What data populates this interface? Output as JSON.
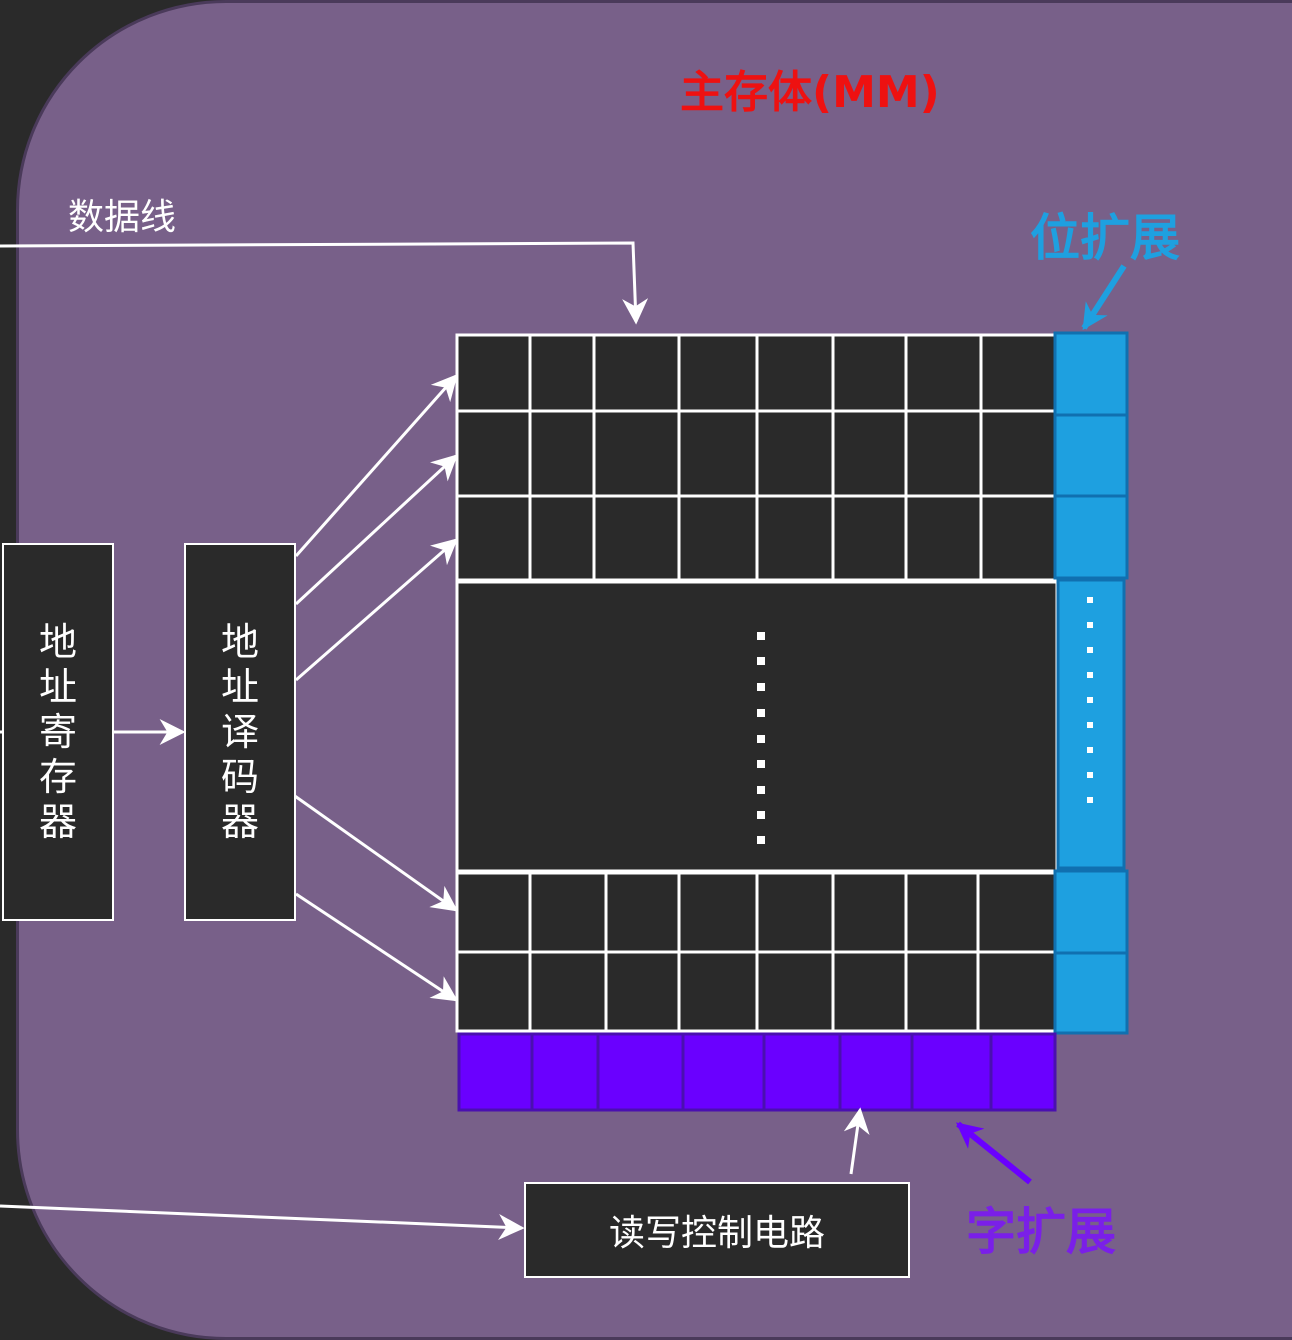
{
  "title": "主存体(MM)",
  "data_line_label": "数据线",
  "bit_expansion_label": "位扩展",
  "word_expansion_label": "字扩展",
  "address_register_label": "地址寄存器",
  "address_decoder_label": "地址译码器",
  "rw_control_label": "读写控制电路",
  "colors": {
    "panel_background": "#786089",
    "page_background": "#2a2a2a",
    "memory_cell": "#2a2a2a",
    "bit_expansion": "#1ea0e0",
    "word_expansion": "#6a00ff",
    "title": "#ee1111",
    "connector": "#ffffff"
  }
}
